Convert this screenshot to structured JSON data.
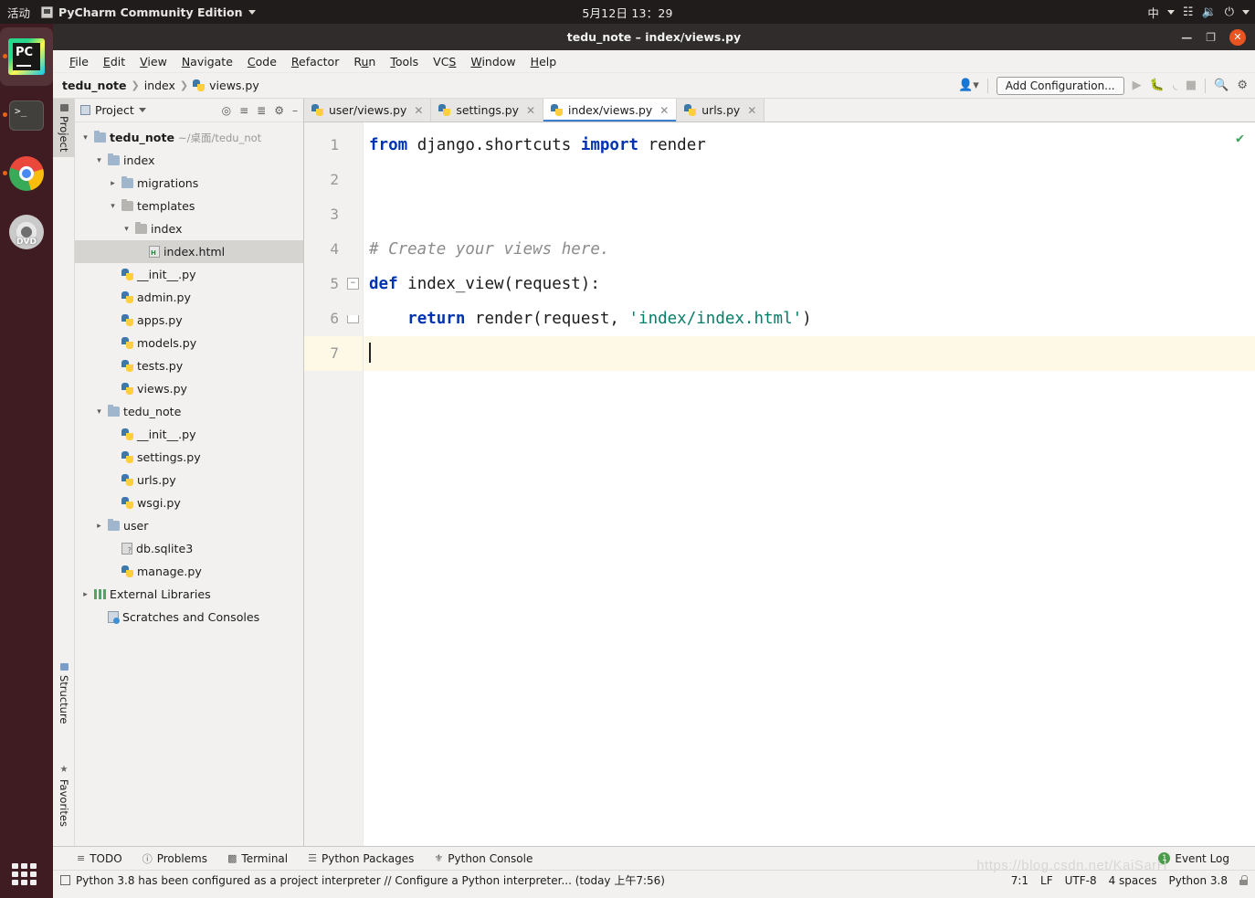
{
  "desktop": {
    "activities": "活动",
    "app_name": "PyCharm Community Edition",
    "clock": "5月12日 13：29",
    "ime": "中",
    "tray": [
      "network-icon",
      "volume-icon",
      "power-icon"
    ],
    "dock": [
      {
        "name": "pycharm",
        "label": "PyCharm",
        "running": true
      },
      {
        "name": "terminal",
        "label": "Terminal",
        "running": true
      },
      {
        "name": "chrome",
        "label": "Google Chrome",
        "running": true
      },
      {
        "name": "ubuntu-installer",
        "label": "DVD",
        "running": false
      }
    ]
  },
  "window": {
    "title": "tedu_note – index/views.py",
    "controls": {
      "minimize": "—",
      "maximize": "❐",
      "close": "✕"
    }
  },
  "menu": [
    {
      "label": "File",
      "mnemonic": "F"
    },
    {
      "label": "Edit",
      "mnemonic": "E"
    },
    {
      "label": "View",
      "mnemonic": "V"
    },
    {
      "label": "Navigate",
      "mnemonic": "N"
    },
    {
      "label": "Code",
      "mnemonic": "C"
    },
    {
      "label": "Refactor",
      "mnemonic": "R"
    },
    {
      "label": "Run",
      "mnemonic": "u"
    },
    {
      "label": "Tools",
      "mnemonic": "T"
    },
    {
      "label": "VCS",
      "mnemonic": "S"
    },
    {
      "label": "Window",
      "mnemonic": "W"
    },
    {
      "label": "Help",
      "mnemonic": "H"
    }
  ],
  "navbar": {
    "breadcrumbs": [
      "tedu_note",
      "index",
      "views.py"
    ],
    "add_configuration": "Add Configuration...",
    "icons": [
      "user-dropdown-icon",
      "run-icon",
      "debug-icon",
      "run-coverage-icon",
      "stop-icon",
      "search-icon",
      "settings-gear-icon"
    ]
  },
  "project_panel": {
    "title": "Project",
    "header_icons": [
      "target-icon",
      "collapse-all-icon",
      "expand-icon",
      "settings-gear-icon",
      "hide-icon"
    ],
    "tree": [
      {
        "label": "tedu_note",
        "path": "~/桌面/tedu_not",
        "depth": 0,
        "arrow": "▾",
        "icon": "folder",
        "bold": true
      },
      {
        "label": "index",
        "depth": 1,
        "arrow": "▾",
        "icon": "folder-blue"
      },
      {
        "label": "migrations",
        "depth": 2,
        "arrow": "▸",
        "icon": "folder-blue"
      },
      {
        "label": "templates",
        "depth": 2,
        "arrow": "▾",
        "icon": "folder"
      },
      {
        "label": "index",
        "depth": 3,
        "arrow": "▾",
        "icon": "folder"
      },
      {
        "label": "index.html",
        "depth": 4,
        "arrow": "",
        "icon": "html",
        "selected": true
      },
      {
        "label": "__init__.py",
        "depth": 2,
        "arrow": "",
        "icon": "python"
      },
      {
        "label": "admin.py",
        "depth": 2,
        "arrow": "",
        "icon": "python"
      },
      {
        "label": "apps.py",
        "depth": 2,
        "arrow": "",
        "icon": "python"
      },
      {
        "label": "models.py",
        "depth": 2,
        "arrow": "",
        "icon": "python"
      },
      {
        "label": "tests.py",
        "depth": 2,
        "arrow": "",
        "icon": "python"
      },
      {
        "label": "views.py",
        "depth": 2,
        "arrow": "",
        "icon": "python"
      },
      {
        "label": "tedu_note",
        "depth": 1,
        "arrow": "▾",
        "icon": "folder-blue"
      },
      {
        "label": "__init__.py",
        "depth": 2,
        "arrow": "",
        "icon": "python"
      },
      {
        "label": "settings.py",
        "depth": 2,
        "arrow": "",
        "icon": "python"
      },
      {
        "label": "urls.py",
        "depth": 2,
        "arrow": "",
        "icon": "python"
      },
      {
        "label": "wsgi.py",
        "depth": 2,
        "arrow": "",
        "icon": "python"
      },
      {
        "label": "user",
        "depth": 1,
        "arrow": "▸",
        "icon": "folder-blue"
      },
      {
        "label": "db.sqlite3",
        "depth": 2,
        "arrow": "",
        "icon": "db"
      },
      {
        "label": "manage.py",
        "depth": 2,
        "arrow": "",
        "icon": "python"
      },
      {
        "label": "External Libraries",
        "depth": 0,
        "arrow": "▸",
        "icon": "library"
      },
      {
        "label": "Scratches and Consoles",
        "depth": 0,
        "arrow": "",
        "icon": "scratch"
      }
    ]
  },
  "rail": {
    "top": [
      "Project"
    ],
    "bottom": [
      "Structure",
      "Favorites"
    ]
  },
  "editor": {
    "tabs": [
      {
        "label": "user/views.py",
        "active": false
      },
      {
        "label": "settings.py",
        "active": false
      },
      {
        "label": "index/views.py",
        "active": true
      },
      {
        "label": "urls.py",
        "active": false
      }
    ],
    "line_numbers": [
      "1",
      "2",
      "3",
      "4",
      "5",
      "6",
      "7"
    ],
    "current_line": 7,
    "code": [
      {
        "n": 1,
        "tokens": [
          {
            "t": "from ",
            "c": "kw"
          },
          {
            "t": "django.shortcuts ",
            "c": "pl"
          },
          {
            "t": "import ",
            "c": "kw"
          },
          {
            "t": "render",
            "c": "pl"
          }
        ]
      },
      {
        "n": 2,
        "tokens": []
      },
      {
        "n": 3,
        "tokens": []
      },
      {
        "n": 4,
        "tokens": [
          {
            "t": "# Create your views here.",
            "c": "cm"
          }
        ]
      },
      {
        "n": 5,
        "tokens": [
          {
            "t": "def ",
            "c": "kw"
          },
          {
            "t": "index_view(request):",
            "c": "pl"
          }
        ],
        "fold": "start"
      },
      {
        "n": 6,
        "tokens": [
          {
            "t": "    ",
            "c": "pl"
          },
          {
            "t": "return ",
            "c": "kw"
          },
          {
            "t": "render(request, ",
            "c": "pl"
          },
          {
            "t": "'index/index.html'",
            "c": "str"
          },
          {
            "t": ")",
            "c": "pl"
          }
        ],
        "fold": "end"
      },
      {
        "n": 7,
        "tokens": []
      }
    ],
    "inspection": "✔"
  },
  "bottom_tabs": [
    {
      "label": "TODO",
      "icon": "list-icon"
    },
    {
      "label": "Problems",
      "icon": "info-icon"
    },
    {
      "label": "Terminal",
      "icon": "terminal-icon"
    },
    {
      "label": "Python Packages",
      "icon": "packages-icon"
    },
    {
      "label": "Python Console",
      "icon": "console-icon"
    }
  ],
  "event_log": {
    "label": "Event Log",
    "count": "1"
  },
  "status": {
    "message": "Python 3.8 has been configured as a project interpreter // Configure a Python interpreter... (today 上午7:56)",
    "caret": "7:1",
    "line_sep": "LF",
    "encoding": "UTF-8",
    "indent": "4 spaces",
    "interpreter": "Python 3.8",
    "lock": "lock-icon",
    "watermark": "https://blog.csdn.net/KaiSarH"
  },
  "colors": {
    "accent": "#3c7fd0",
    "keyword": "#0033b3",
    "string": "#067d68",
    "comment": "#8c8c8c",
    "ok": "#3aa357",
    "close": "#e95420"
  }
}
